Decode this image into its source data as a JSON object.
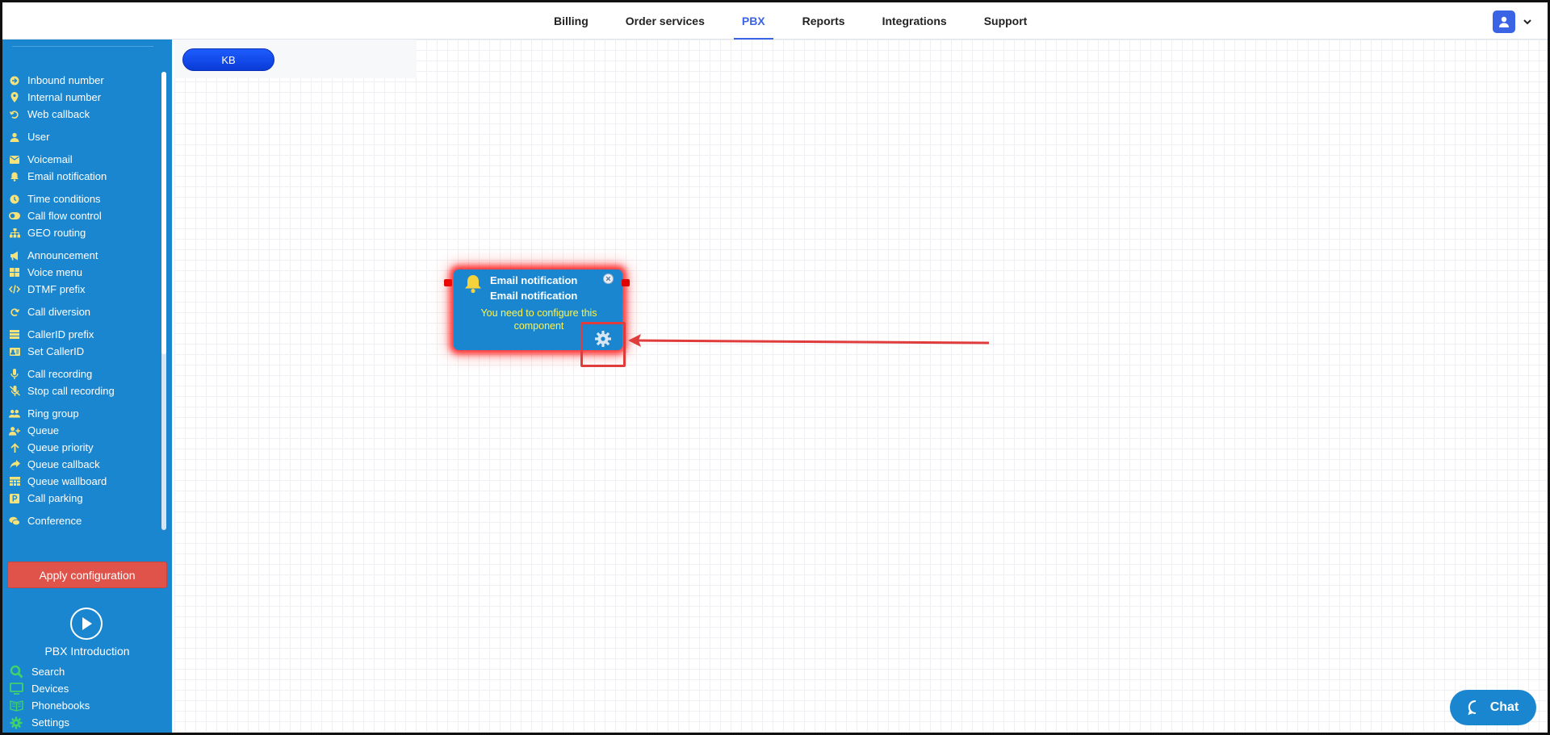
{
  "topnav": {
    "items": [
      {
        "label": "Billing"
      },
      {
        "label": "Order services"
      },
      {
        "label": "PBX",
        "active": true
      },
      {
        "label": "Reports"
      },
      {
        "label": "Integrations"
      },
      {
        "label": "Support"
      }
    ]
  },
  "sidebar": {
    "items": [
      {
        "label": "Inbound number",
        "icon": "arrow-circle-icon"
      },
      {
        "label": "Internal number",
        "icon": "map-pin-icon"
      },
      {
        "label": "Web callback",
        "icon": "undo-icon"
      },
      {
        "label": "User",
        "icon": "user-icon"
      },
      {
        "label": "Voicemail",
        "icon": "envelope-icon"
      },
      {
        "label": "Email notification",
        "icon": "bell-icon"
      },
      {
        "label": "Time conditions",
        "icon": "clock-icon"
      },
      {
        "label": "Call flow control",
        "icon": "toggle-icon"
      },
      {
        "label": "GEO routing",
        "icon": "sitemap-icon"
      },
      {
        "label": "Announcement",
        "icon": "megaphone-icon"
      },
      {
        "label": "Voice menu",
        "icon": "grid-icon"
      },
      {
        "label": "DTMF prefix",
        "icon": "code-icon"
      },
      {
        "label": "Call diversion",
        "icon": "redo-icon"
      },
      {
        "label": "CallerID prefix",
        "icon": "list-icon"
      },
      {
        "label": "Set CallerID",
        "icon": "id-card-icon"
      },
      {
        "label": "Call recording",
        "icon": "microphone-icon"
      },
      {
        "label": "Stop call recording",
        "icon": "microphone-slash-icon"
      },
      {
        "label": "Ring group",
        "icon": "users-icon"
      },
      {
        "label": "Queue",
        "icon": "user-plus-icon"
      },
      {
        "label": "Queue priority",
        "icon": "arrow-up-icon"
      },
      {
        "label": "Queue callback",
        "icon": "share-icon"
      },
      {
        "label": "Queue wallboard",
        "icon": "table-icon"
      },
      {
        "label": "Call parking",
        "icon": "parking-icon"
      },
      {
        "label": "Conference",
        "icon": "comments-icon"
      }
    ],
    "apply_label": "Apply configuration",
    "intro_label": "PBX Introduction",
    "bottom": [
      {
        "label": "Search",
        "icon": "search-icon"
      },
      {
        "label": "Devices",
        "icon": "monitor-icon"
      },
      {
        "label": "Phonebooks",
        "icon": "book-icon"
      },
      {
        "label": "Settings",
        "icon": "gear-icon"
      }
    ]
  },
  "canvas": {
    "kb_label": "KB",
    "node": {
      "title": "Email notification",
      "subtitle": "Email notification",
      "warning": "You need to configure this component"
    }
  },
  "chat": {
    "label": "Chat"
  },
  "colors": {
    "sidebar_bg": "#1a86cf",
    "accent": "#3b63e6",
    "apply_button": "#e0534b",
    "warning_text": "#fff44f",
    "highlight": "#e03c3c",
    "icon_yellow": "#f6e27a"
  }
}
